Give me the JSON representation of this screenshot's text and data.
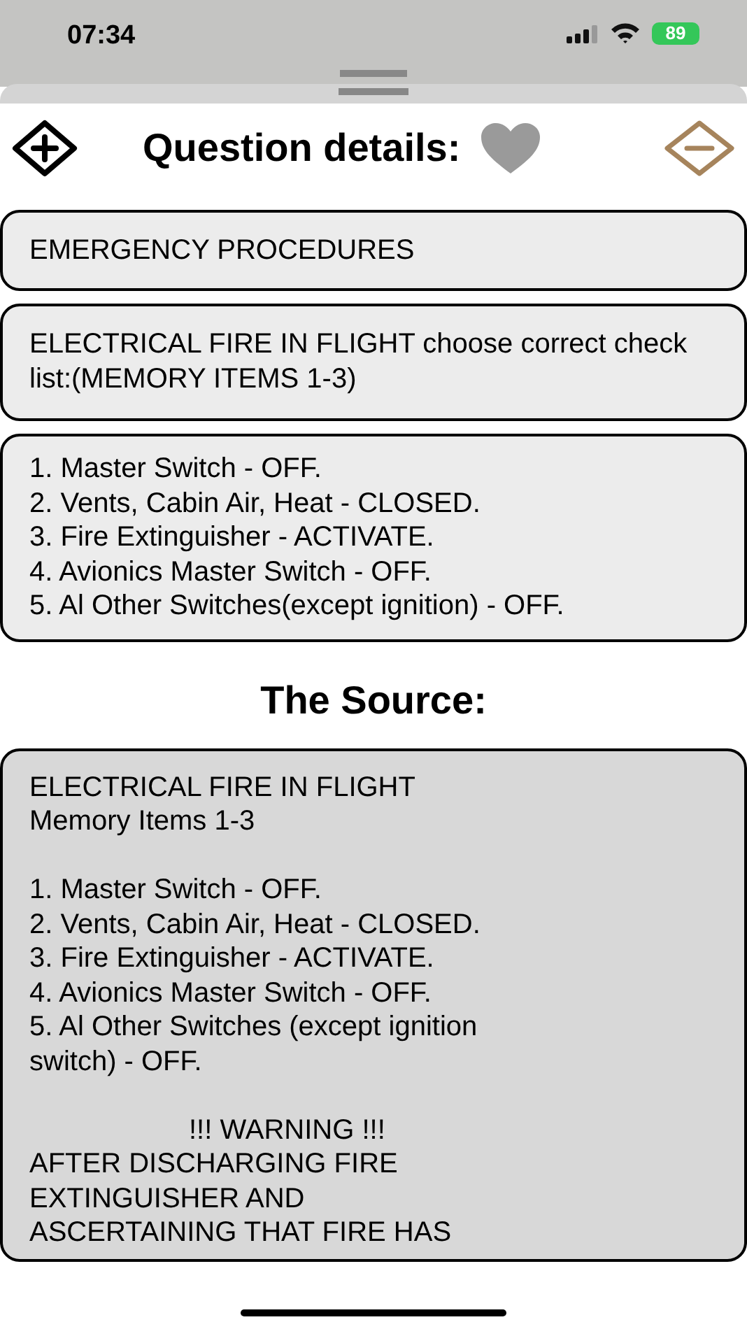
{
  "status_bar": {
    "time": "07:34",
    "battery": "89"
  },
  "header": {
    "title": "Question details:",
    "favorite": false
  },
  "category": "EMERGENCY PROCEDURES",
  "question": "ELECTRICAL FIRE IN FLIGHT choose correct check list:(MEMORY ITEMS 1-3)",
  "answer_lines": [
    "1. Master Switch - OFF.",
    "2. Vents, Cabin Air, Heat - CLOSED.",
    "3. Fire Extinguisher - ACTIVATE.",
    "4. Avionics Master Switch - OFF.",
    "5. Al Other Switches(except ignition) - OFF."
  ],
  "source": {
    "title": "The Source:",
    "paragraphs": [
      {
        "kind": "left",
        "text": "ELECTRICAL FIRE IN FLIGHT\nMemory Items 1-3"
      },
      {
        "kind": "left",
        "text": "1. Master Switch - OFF.\n2. Vents, Cabin Air, Heat - CLOSED.\n3. Fire Extinguisher - ACTIVATE.\n4. Avionics Master Switch - OFF.\n5. Al Other Switches (except ignition\nswitch) - OFF."
      },
      {
        "kind": "warning",
        "text": "!!! WARNING !!!"
      },
      {
        "kind": "left",
        "text": "AFTER DISCHARGING FIRE\nEXTINGUISHER AND\nASCERTAINING THAT FIRE HAS"
      }
    ]
  }
}
